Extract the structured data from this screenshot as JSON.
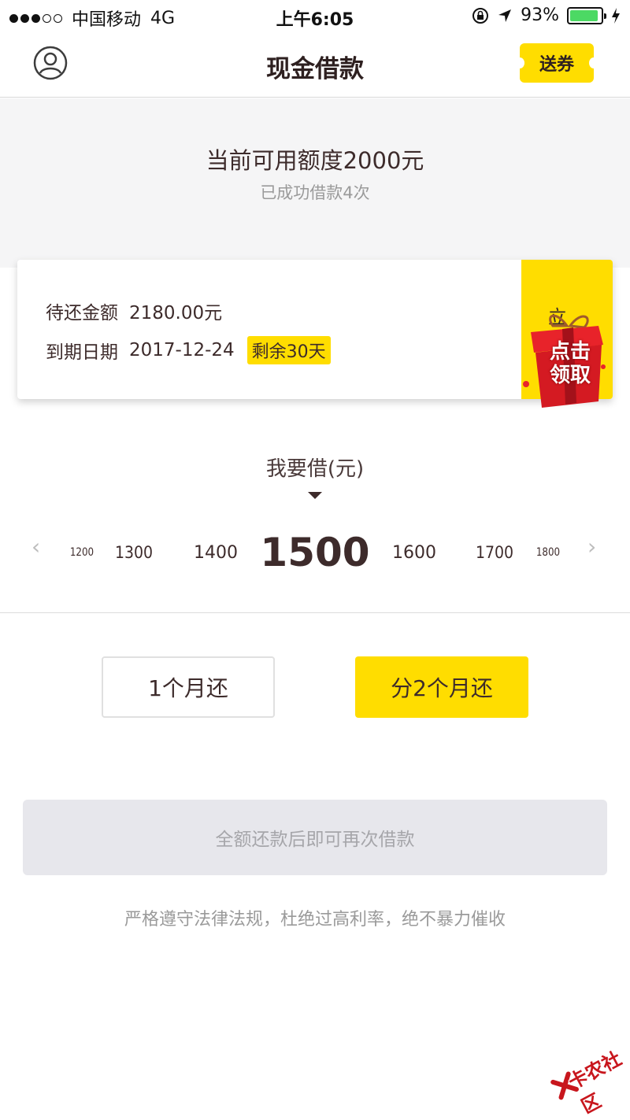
{
  "status_bar": {
    "carrier": "中国移动",
    "network": "4G",
    "time": "上午6:05",
    "battery": "93%",
    "battery_level": 0.93
  },
  "nav": {
    "title": "现金借款",
    "coupon_label": "送券"
  },
  "summary": {
    "available": "当前可用额度2000元",
    "history": "已成功借款4次"
  },
  "repay_card": {
    "due_label": "待还金额",
    "due_value": "2180.00元",
    "date_label": "到期日期",
    "date_value": "2017-12-24",
    "remaining": "剩余30天",
    "side_label": "立即还",
    "gift_line1": "点击",
    "gift_line2": "领取"
  },
  "selector": {
    "label": "我要借(元)",
    "amounts": [
      "1200",
      "1300",
      "1400",
      "1500",
      "1600",
      "1700",
      "1800"
    ],
    "selected": "1500"
  },
  "terms": {
    "option1": "1个月还",
    "option2": "分2个月还",
    "selected": "分2个月还"
  },
  "submit": {
    "label": "全额还款后即可再次借款"
  },
  "notice": "严格遵守法律法规，杜绝过高利率，绝不暴力催收",
  "watermark": "卡农社区",
  "colors": {
    "accent": "#ffdd00",
    "text": "#3d2b2b",
    "muted": "#9a9a9a",
    "disabled_bg": "#e7e7ec"
  }
}
